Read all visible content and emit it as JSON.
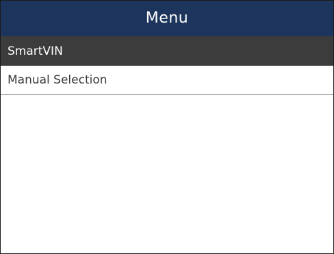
{
  "header": {
    "title": "Menu"
  },
  "menu": {
    "items": [
      {
        "label": "SmartVIN",
        "selected": true
      },
      {
        "label": "Manual Selection",
        "selected": false
      }
    ]
  },
  "colors": {
    "header_bg": "#1d355d",
    "selected_bg": "#3c3c3c",
    "divider": "#6f6f6f"
  }
}
